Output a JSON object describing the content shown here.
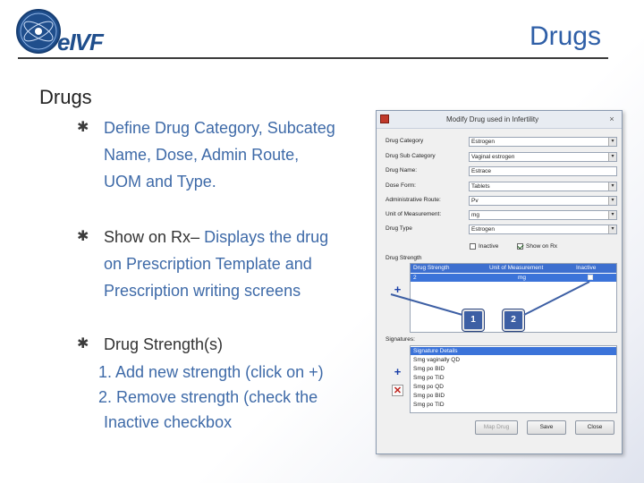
{
  "header": {
    "logo_text": "eIVF",
    "slide_title": "Drugs"
  },
  "section_title": "Drugs",
  "bullets": {
    "b1": [
      "Define Drug Category, Subcateg",
      "Name, Dose, Admin Route,",
      "UOM and Type."
    ],
    "b2": {
      "lead": "Show on Rx",
      "dash": "–",
      "rest": " Displays the drug",
      "line2": "on Prescription Template and",
      "line3": "Prescription writing screens"
    },
    "b3": {
      "title": "Drug Strength(s)",
      "items": [
        "1.  Add new strength (click on +)",
        "2.  Remove strength (check the",
        "Inactive checkbox"
      ]
    }
  },
  "dialog": {
    "title": "Modify Drug used in Infertility",
    "close_glyph": "×",
    "fields": [
      {
        "label": "Drug Category",
        "value": "Estrogen"
      },
      {
        "label": "Drug Sub Category",
        "value": "Vaginal estrogen"
      },
      {
        "label": "Drug Name:",
        "value": "Estrace"
      },
      {
        "label": "Dose Form:",
        "value": "Tablets"
      },
      {
        "label": "Administrative Route:",
        "value": "Pv"
      },
      {
        "label": "Unit of Measurement:",
        "value": "mg"
      },
      {
        "label": "Drug Type",
        "value": "Estrogen"
      }
    ],
    "checkboxes": {
      "inactive": {
        "label": "Inactive",
        "checked": false
      },
      "show_on_rx": {
        "label": "Show on Rx",
        "checked": true
      }
    },
    "strength_group_label": "Drug Strength",
    "strength_headers": [
      "Drug Strength",
      "Unit of Measurement",
      "Inactive"
    ],
    "strength_rows": [
      {
        "strength": "2",
        "uom": "mg"
      }
    ],
    "signature_group_label": "Signatures:",
    "signature_rows": [
      "Signature Details",
      "Smg vaginally QD",
      "Smg po BID",
      "Smg po TID",
      "Smg po QD",
      "Smg po BID",
      "Smg po TID"
    ],
    "callouts": [
      "1",
      "2"
    ],
    "buttons": {
      "map": "Map Drug",
      "save": "Save",
      "close": "Close"
    },
    "icons": {
      "add": "+",
      "delete": "✕"
    }
  }
}
